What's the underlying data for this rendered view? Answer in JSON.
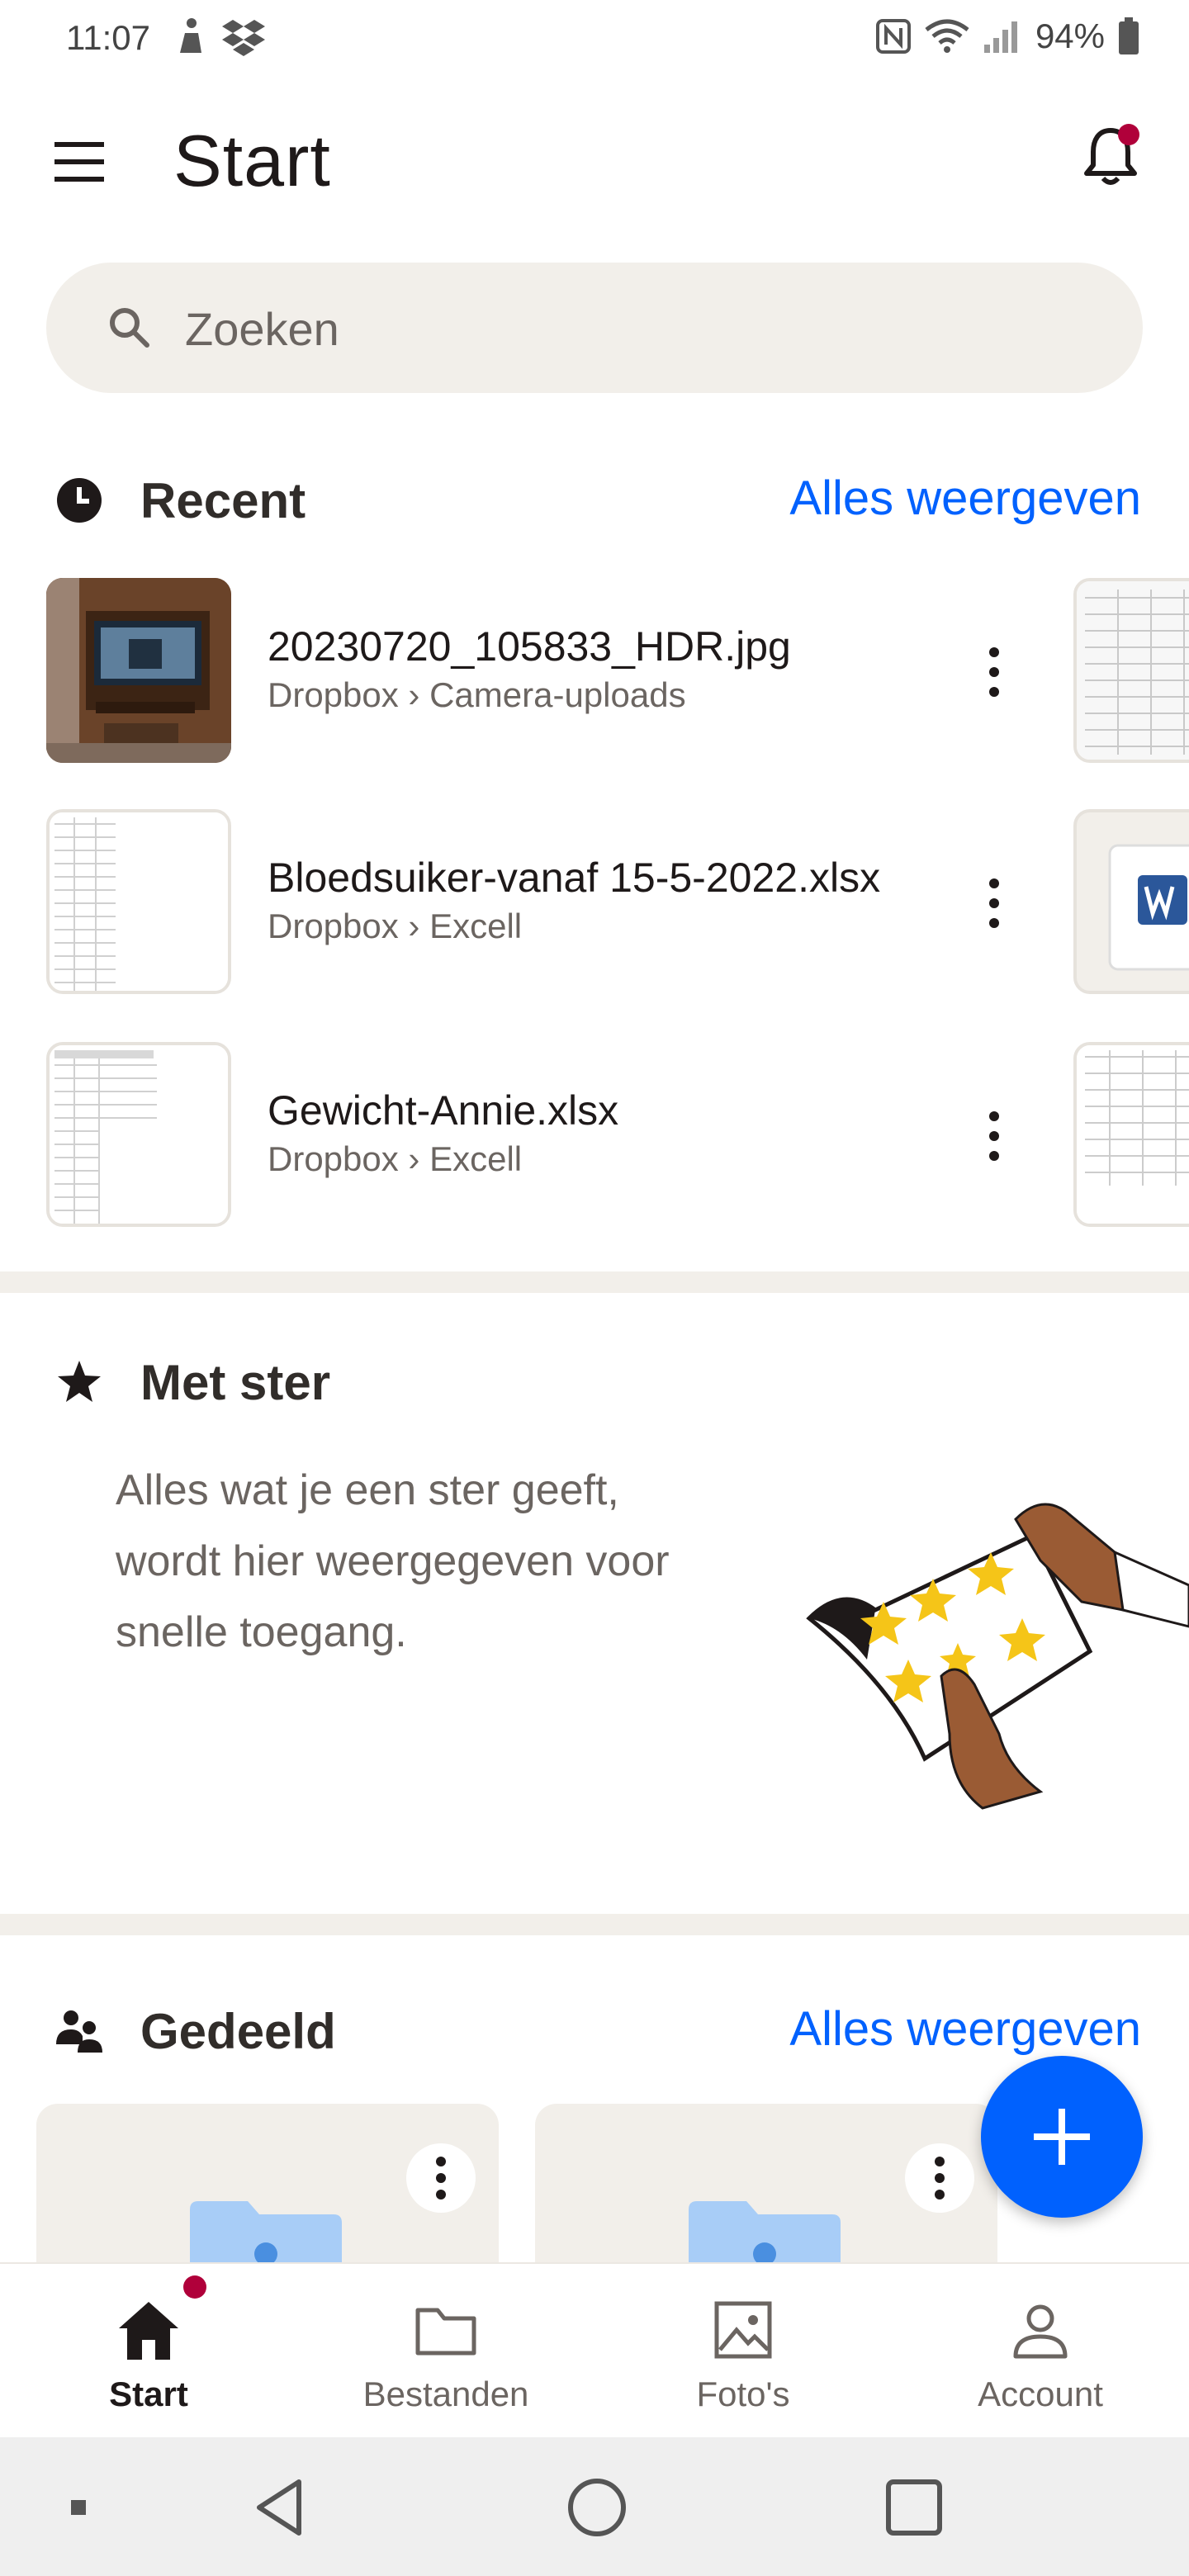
{
  "status_bar": {
    "time": "11:07",
    "battery": "94%"
  },
  "header": {
    "title": "Start"
  },
  "search": {
    "placeholder": "Zoeken"
  },
  "recent": {
    "title": "Recent",
    "view_all": "Alles weergeven",
    "items": [
      {
        "name": "20230720_105833_HDR.jpg",
        "path": "Dropbox › Camera-uploads"
      },
      {
        "name": "Bloedsuiker-vanaf 15-5-2022.xlsx",
        "path": "Dropbox › Excell"
      },
      {
        "name": "Gewicht-Annie.xlsx",
        "path": "Dropbox › Excell"
      }
    ]
  },
  "starred": {
    "title": "Met ster",
    "empty_text": "Alles wat je een ster geeft, wordt hier weergegeven voor snelle toegang."
  },
  "shared": {
    "title": "Gedeeld",
    "view_all": "Alles weergeven"
  },
  "bottom_nav": {
    "items": [
      {
        "label": "Start",
        "icon": "home-icon",
        "active": true
      },
      {
        "label": "Bestanden",
        "icon": "folder-icon",
        "active": false
      },
      {
        "label": "Foto's",
        "icon": "photo-icon",
        "active": false
      },
      {
        "label": "Account",
        "icon": "person-icon",
        "active": false
      }
    ]
  },
  "colors": {
    "accent": "#0061fe",
    "notification": "#b0003a",
    "surface": "#f2efea"
  }
}
